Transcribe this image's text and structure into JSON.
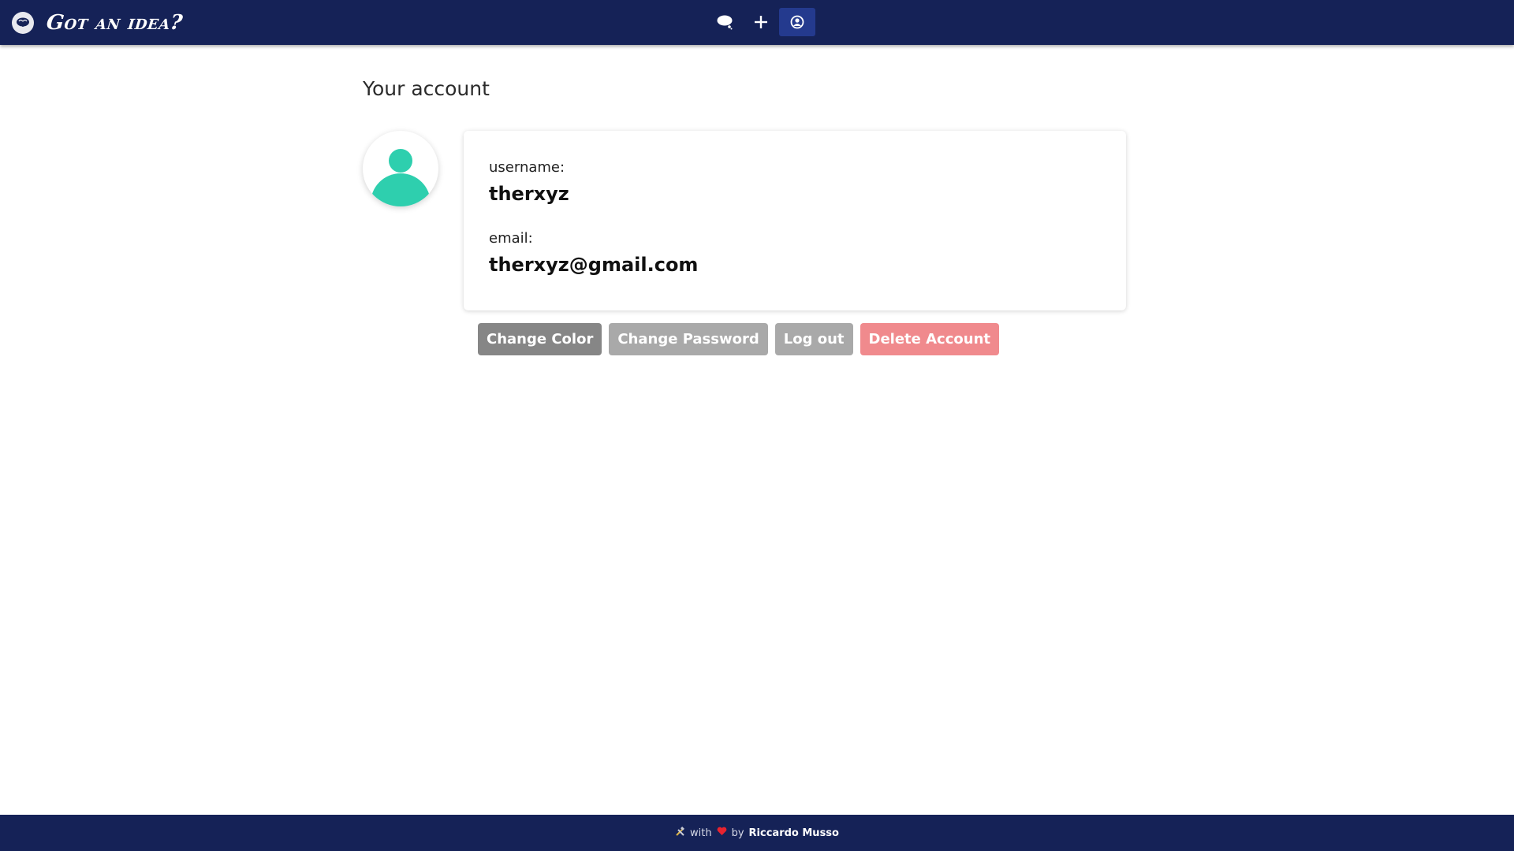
{
  "navbar": {
    "brand_title": "Got an idea?",
    "icons": [
      "brain-logo-icon",
      "chat-icon",
      "plus-icon",
      "user-circle-icon"
    ],
    "background": "#152257",
    "active_background": "#243a8e"
  },
  "page": {
    "title": "Your account"
  },
  "profile": {
    "avatar_color": "#2ecfae",
    "username_label": "username:",
    "username": "therxyz",
    "email_label": "email:",
    "email": "therxyz@gmail.com"
  },
  "actions": {
    "change_color": "Change Color",
    "change_password": "Change Password",
    "log_out": "Log out",
    "delete_account": "Delete Account"
  },
  "footer": {
    "tools_icon": "hammer-wrench-icon",
    "with": "with",
    "heart_icon": "heart-icon",
    "by": "by",
    "author": "Riccardo Musso"
  }
}
